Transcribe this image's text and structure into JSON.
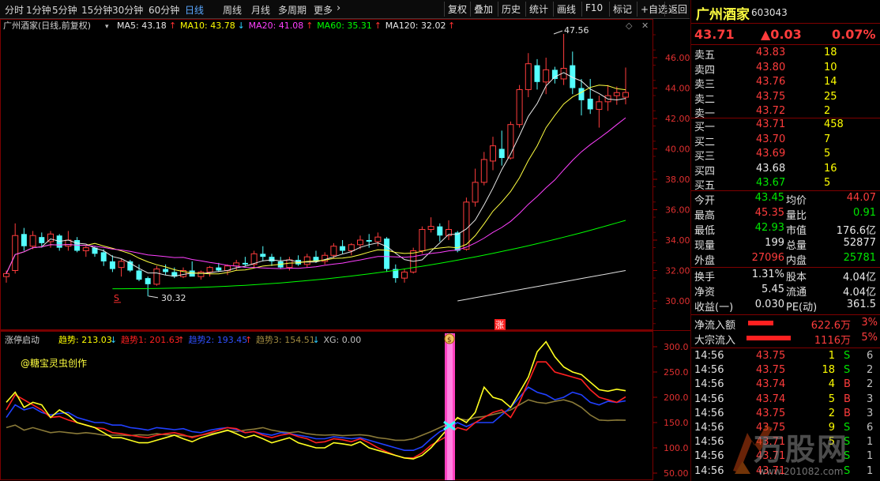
{
  "toolbar": {
    "periods": [
      "分时",
      "1分钟",
      "5分钟",
      "15分钟",
      "30分钟",
      "60分钟",
      "日线",
      "周线",
      "月线",
      "多周期",
      "更多"
    ],
    "active_period": "日线",
    "more_arrow": "›",
    "right_buttons": [
      "复权",
      "叠加",
      "历史",
      "统计",
      "画线",
      "F10",
      "标记",
      "+自选",
      "返回"
    ]
  },
  "main_chart": {
    "title": "广州酒家(日线,前复权)",
    "ma_legend": [
      {
        "label": "MA5: 43.18",
        "arrow": "↑",
        "color": "#e8e8e8"
      },
      {
        "label": "MA10: 43.78",
        "arrow": "↓",
        "color": "#ffff00"
      },
      {
        "label": "MA20: 41.08",
        "arrow": "↑",
        "color": "#ff40ff"
      },
      {
        "label": "MA60: 35.31",
        "arrow": "↑",
        "color": "#00ff00"
      },
      {
        "label": "MA120: 32.02",
        "arrow": "↑",
        "color": "#e8e8e8"
      }
    ],
    "y_ticks": [
      "46.00",
      "44.00",
      "42.00",
      "40.00",
      "38.00",
      "36.00",
      "34.00",
      "32.00",
      "30.00"
    ],
    "high_label": "47.56",
    "low_label": "30.32",
    "s_marker": "S",
    "zhang_marker": "涨",
    "up_color": "#ff3c3c",
    "down_color": "#54ffff"
  },
  "sub_chart": {
    "title": "涨停启动",
    "legend": [
      {
        "label": "趋势: 213.03",
        "arrow": "↓",
        "color": "#ffff00"
      },
      {
        "label": "趋势1: 201.63",
        "arrow": "↑",
        "color": "#ff2020"
      },
      {
        "label": "趋势2: 193.45",
        "arrow": "↑",
        "color": "#3050ff"
      },
      {
        "label": "趋势3: 154.51",
        "arrow": "↓",
        "color": "#a08a40"
      },
      {
        "label": "XG: 0.00",
        "arrow": "",
        "color": "#c0c0c0"
      }
    ],
    "author": "@糖宝灵虫创作",
    "y_ticks": [
      "300.0",
      "250.0",
      "200.0",
      "150.0",
      "100.0",
      "50.00"
    ],
    "dollar": "$"
  },
  "quote": {
    "name": "广州酒家",
    "code": "603043",
    "price": "43.71",
    "change": "▲0.03",
    "change_pct": "0.07%",
    "asks": [
      {
        "label": "卖五",
        "price": "43.83",
        "vol": "18"
      },
      {
        "label": "卖四",
        "price": "43.80",
        "vol": "10"
      },
      {
        "label": "卖三",
        "price": "43.76",
        "vol": "14"
      },
      {
        "label": "卖二",
        "price": "43.75",
        "vol": "25"
      },
      {
        "label": "卖一",
        "price": "43.72",
        "vol": "2"
      }
    ],
    "bids": [
      {
        "label": "买一",
        "price": "43.71",
        "vol": "458"
      },
      {
        "label": "买二",
        "price": "43.70",
        "vol": "7"
      },
      {
        "label": "买三",
        "price": "43.69",
        "vol": "5"
      },
      {
        "label": "买四",
        "price": "43.68",
        "vol": "16"
      },
      {
        "label": "买五",
        "price": "43.67",
        "vol": "5"
      }
    ],
    "stats": [
      {
        "l1": "今开",
        "v1": "43.45",
        "c1": "grn",
        "l2": "均价",
        "v2": "44.07",
        "c2": "red"
      },
      {
        "l1": "最高",
        "v1": "45.35",
        "c1": "red",
        "l2": "量比",
        "v2": "0.91",
        "c2": "grn"
      },
      {
        "l1": "最低",
        "v1": "42.93",
        "c1": "grn",
        "l2": "市值",
        "v2": "176.6亿",
        "c2": "wht"
      },
      {
        "l1": "现量",
        "v1": "199",
        "c1": "wht",
        "l2": "总量",
        "v2": "52877",
        "c2": "wht"
      },
      {
        "l1": "外盘",
        "v1": "27096",
        "c1": "red",
        "l2": "内盘",
        "v2": "25781",
        "c2": "grn"
      }
    ],
    "stats2": [
      {
        "l1": "换手",
        "v1": "1.31%",
        "c1": "wht",
        "l2": "股本",
        "v2": "4.04亿",
        "c2": "wht"
      },
      {
        "l1": "净资",
        "v1": "5.45",
        "c1": "wht",
        "l2": "流通",
        "v2": "4.04亿",
        "c2": "wht"
      },
      {
        "l1": "收益(一)",
        "v1": "0.030",
        "c1": "wht",
        "l2": "PE(动)",
        "v2": "361.5",
        "c2": "wht"
      }
    ],
    "flows": [
      {
        "label": "净流入额",
        "value": "622.6万",
        "pct": "3%"
      },
      {
        "label": "大宗流入",
        "value": "1116万",
        "pct": "5%"
      }
    ],
    "ticks": [
      {
        "time": "14:56",
        "price": "43.75",
        "vol": "1",
        "side": "S"
      },
      {
        "time": "14:56",
        "price": "43.75",
        "vol": "18",
        "side": "S"
      },
      {
        "time": "14:56",
        "price": "43.74",
        "vol": "4",
        "side": "B"
      },
      {
        "time": "14:56",
        "price": "43.74",
        "vol": "5",
        "side": "B"
      },
      {
        "time": "14:56",
        "price": "43.75",
        "vol": "2",
        "side": "B"
      },
      {
        "time": "14:56",
        "price": "43.75",
        "vol": "9",
        "side": "S"
      },
      {
        "time": "14:56",
        "price": "43.71",
        "vol": "5",
        "side": "S"
      },
      {
        "time": "14:56",
        "price": "43.71",
        "vol": "",
        "side": "S"
      },
      {
        "time": "14:56",
        "price": "43.71",
        "vol": "",
        "side": "S"
      }
    ],
    "tick_trail": [
      "6",
      "2",
      "2",
      "3",
      "3",
      "6",
      "1",
      "1",
      "1"
    ],
    "watermark": "万股网",
    "watermark_url": "www.201082.com"
  }
}
